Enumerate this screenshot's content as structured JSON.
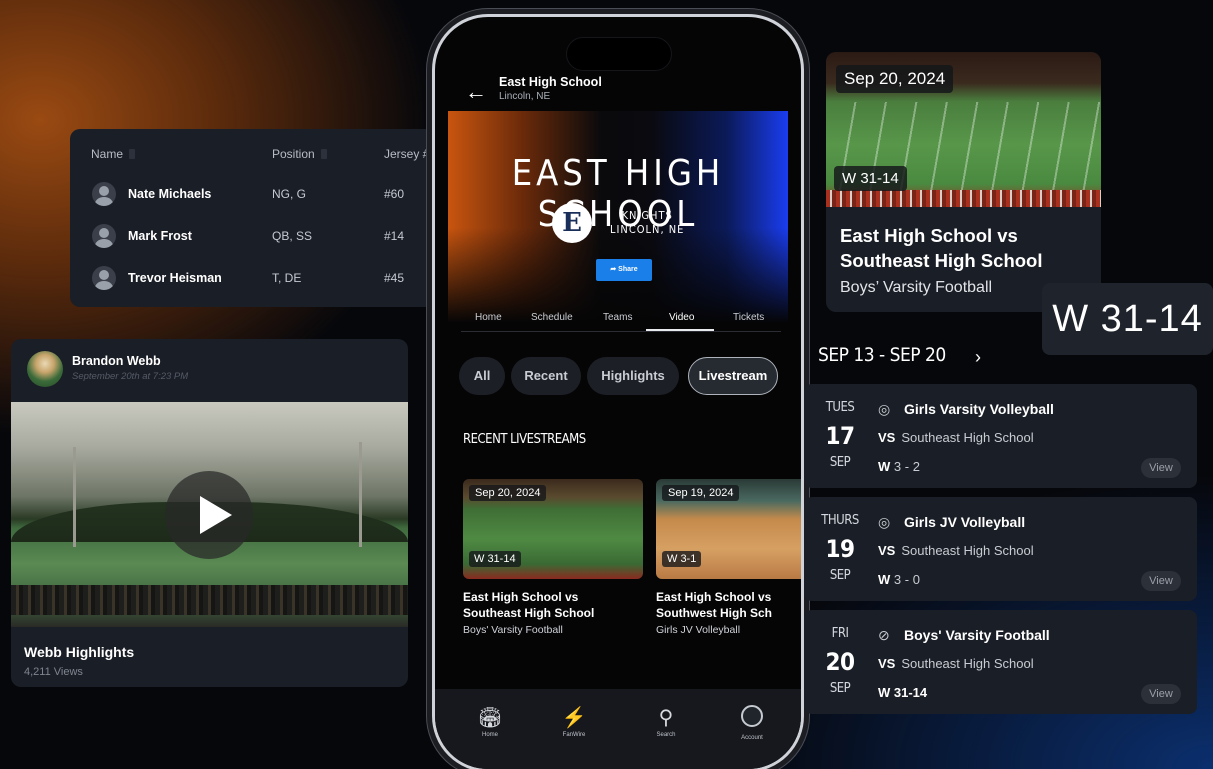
{
  "roster": {
    "headers": [
      "Name",
      "Position",
      "Jersey #"
    ],
    "rows": [
      {
        "name": "Nate Michaels",
        "position": "NG, G",
        "jersey": "#60"
      },
      {
        "name": "Mark Frost",
        "position": "QB, SS",
        "jersey": "#14"
      },
      {
        "name": "Trevor Heisman",
        "position": "T, DE",
        "jersey": "#45"
      }
    ]
  },
  "post": {
    "author": "Brandon Webb",
    "date": "September 20th at 7:23 PM",
    "title": "Webb Highlights",
    "views": "4,211 Views"
  },
  "phone": {
    "school": "East High School",
    "location": "Lincoln, NE",
    "banner_title": "EAST HIGH SCHOOL",
    "logo_letter": "E",
    "mascot": "KNIGHTS",
    "mascot_location": "LINCOLN, NE",
    "share_label": "Share",
    "tabs": [
      "Home",
      "Schedule",
      "Teams",
      "Video",
      "Tickets"
    ],
    "active_tab": "Video",
    "filters": [
      "All",
      "Recent",
      "Highlights",
      "Livestream"
    ],
    "active_filter": "Livestream",
    "section_title": "RECENT LIVESTREAMS",
    "livestreams": [
      {
        "date": "Sep 20, 2024",
        "score": "W 31-14",
        "title1": "East High School vs",
        "title2": "Southeast High School",
        "sport": "Boys' Varsity Football"
      },
      {
        "date": "Sep 19, 2024",
        "score": "W 3-1",
        "title1": "East High School vs",
        "title2": "Southwest High Sch",
        "sport": "Girls JV Volleyball"
      }
    ],
    "nav": [
      "Home",
      "FanWire",
      "Search",
      "Account"
    ]
  },
  "featured": {
    "date": "Sep 20, 2024",
    "score": "W 31-14",
    "title1": "East High School vs",
    "title2": "Southeast High School",
    "sport": "Boys’ Varsity Football",
    "big_score": "W 31-14"
  },
  "schedule": {
    "range": "SEP 13 - SEP 20",
    "games": [
      {
        "dow": "TUES",
        "day": "17",
        "month": "SEP",
        "sport_icon": "volleyball-icon",
        "title": "Girls Varsity Volleyball",
        "vs": "VS",
        "opponent": "Southeast High School",
        "result_prefix": "W",
        "result": "3 - 2",
        "view": "View"
      },
      {
        "dow": "THURS",
        "day": "19",
        "month": "SEP",
        "sport_icon": "volleyball-icon",
        "title": "Girls JV Volleyball",
        "vs": "VS",
        "opponent": "Southeast High School",
        "result_prefix": "W",
        "result": "3 - 0",
        "view": "View"
      },
      {
        "dow": "FRI",
        "day": "20",
        "month": "SEP",
        "sport_icon": "football-icon",
        "title": "Boys' Varsity Football",
        "vs": "VS",
        "opponent": "Southeast High School",
        "result_prefix": "",
        "result": "W 31-14",
        "view": "View"
      }
    ]
  },
  "colors": {
    "accent_blue": "#1a7fe8",
    "brand_orange": "#c9550f",
    "card_bg": "#1a1e26"
  }
}
